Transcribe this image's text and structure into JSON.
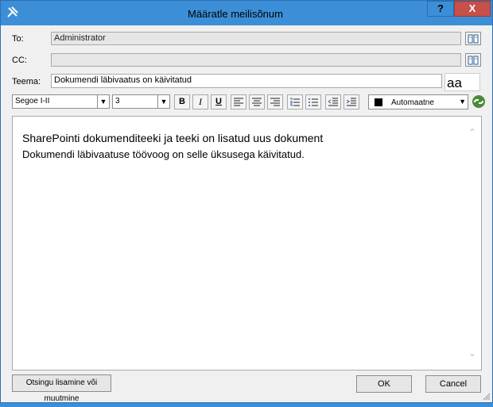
{
  "window": {
    "title": "Määratle meilisõnum",
    "help_label": "?",
    "close_label": "X"
  },
  "fields": {
    "to_label": "To:",
    "to_value": "Administrator",
    "cc_label": "CC:",
    "cc_value": "",
    "subject_label": "Teema:",
    "subject_value": "Dokumendi läbivaatus on käivitatud",
    "dynamic_text_label": "aa"
  },
  "toolbar": {
    "font_family": "Segoe I-II",
    "font_size": "3",
    "bold_label": "B",
    "italic_label": "I",
    "underline_label": "U",
    "font_color_label": "Automaatne",
    "font_color": "#000000"
  },
  "body": {
    "line1": "SharePointi dokumenditeeki ja teeki on lisatud uus dokument",
    "line2": "Dokumendi läbivaatuse töövoog on selle üksusega käivitatud."
  },
  "buttons": {
    "lookup_label": "Otsingu lisamine või muutmine",
    "ok_label": "OK",
    "cancel_label": "Cancel"
  },
  "colors": {
    "titlebar": "#3c8fd6",
    "close": "#c7504b",
    "dialog_bg": "#f0f0f0"
  }
}
